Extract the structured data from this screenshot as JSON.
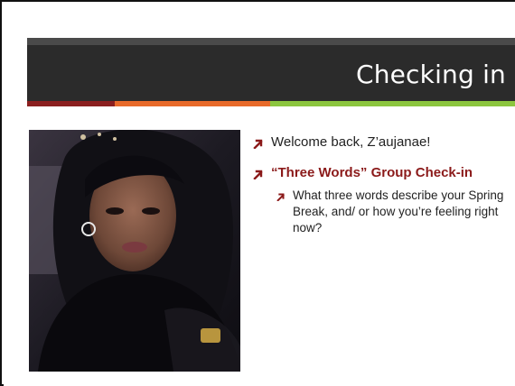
{
  "slide": {
    "title": "Checking in",
    "accent_colors": [
      "#8b1f1f",
      "#e86a2a",
      "#8cc63f"
    ],
    "bullets": [
      {
        "icon": "arrow-bullet-icon",
        "text": "Welcome back, Z’aujanae!",
        "emphasis": false
      },
      {
        "icon": "arrow-bullet-icon",
        "text": "“Three Words” Group Check-in",
        "emphasis": true,
        "sub": [
          {
            "icon": "arrow-bullet-icon",
            "text": "What three words describe your Spring Break, and/ or how you’re feeling right now?"
          }
        ]
      }
    ],
    "bullet_color": "#8b1a1a",
    "photo": {
      "icon": "portrait-photo"
    }
  }
}
